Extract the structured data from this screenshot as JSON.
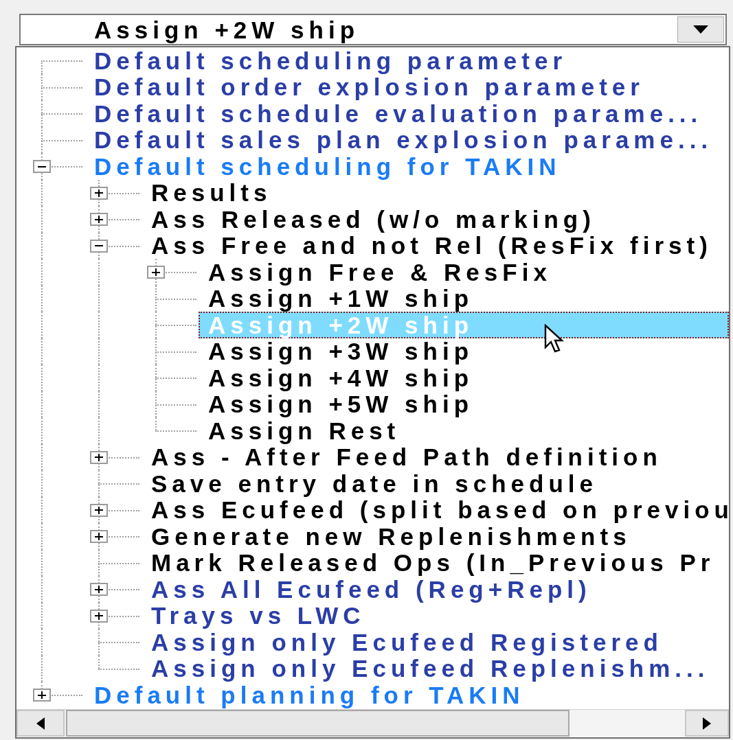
{
  "combo": {
    "value": "Assign +2W ship"
  },
  "tree": [
    {
      "label": "Default scheduling parameter",
      "color": "#2b3ea6",
      "selected": false
    },
    {
      "label": "Default order explosion parameter",
      "color": "#2b3ea6",
      "selected": false
    },
    {
      "label": "Default schedule evaluation parame...",
      "color": "#2b3ea6",
      "selected": false
    },
    {
      "label": "Default sales plan explosion parame...",
      "color": "#2b3ea6",
      "selected": false
    },
    {
      "label": "Default scheduling for TAKIN",
      "color": "#1a7cf5",
      "selected": false,
      "expanded": true,
      "children": [
        {
          "label": "Results",
          "color": "#000000",
          "selected": false,
          "expanded": false
        },
        {
          "label": "Ass Released (w/o marking)",
          "color": "#000000",
          "selected": false,
          "expanded": false
        },
        {
          "label": "Ass Free and not Rel (ResFix first)",
          "color": "#000000",
          "selected": false,
          "expanded": true,
          "children": [
            {
              "label": "Assign Free & ResFix",
              "color": "#000000",
              "selected": false,
              "expanded": false
            },
            {
              "label": "Assign +1W ship",
              "color": "#000000",
              "selected": false
            },
            {
              "label": "Assign +2W ship",
              "selected": true
            },
            {
              "label": "Assign +3W ship",
              "color": "#000000",
              "selected": false
            },
            {
              "label": "Assign +4W ship",
              "color": "#000000",
              "selected": false
            },
            {
              "label": "Assign +5W ship",
              "color": "#000000",
              "selected": false
            },
            {
              "label": "Assign Rest",
              "color": "#000000",
              "selected": false
            }
          ]
        },
        {
          "label": "Ass - After Feed Path definition",
          "color": "#000000",
          "selected": false,
          "expanded": false
        },
        {
          "label": "Save entry date in schedule",
          "color": "#000000",
          "selected": false
        },
        {
          "label": "Ass Ecufeed (split based on previou",
          "color": "#000000",
          "selected": false,
          "expanded": false
        },
        {
          "label": "Generate new Replenishments",
          "color": "#000000",
          "selected": false,
          "expanded": false
        },
        {
          "label": "Mark Released Ops (In_Previous Pr",
          "color": "#000000",
          "selected": false
        },
        {
          "label": "Ass All Ecufeed (Reg+Repl)",
          "color": "#2b3ea6",
          "selected": false,
          "expanded": false
        },
        {
          "label": "Trays vs LWC",
          "color": "#2b3ea6",
          "selected": false,
          "expanded": false
        },
        {
          "label": "Assign only Ecufeed Registered",
          "color": "#2b3ea6",
          "selected": false
        },
        {
          "label": "Assign only Ecufeed Replenishm...",
          "color": "#2b3ea6",
          "selected": false
        }
      ]
    },
    {
      "label": "Default planning for TAKIN",
      "color": "#1a7cf5",
      "selected": false,
      "expanded": false
    }
  ]
}
